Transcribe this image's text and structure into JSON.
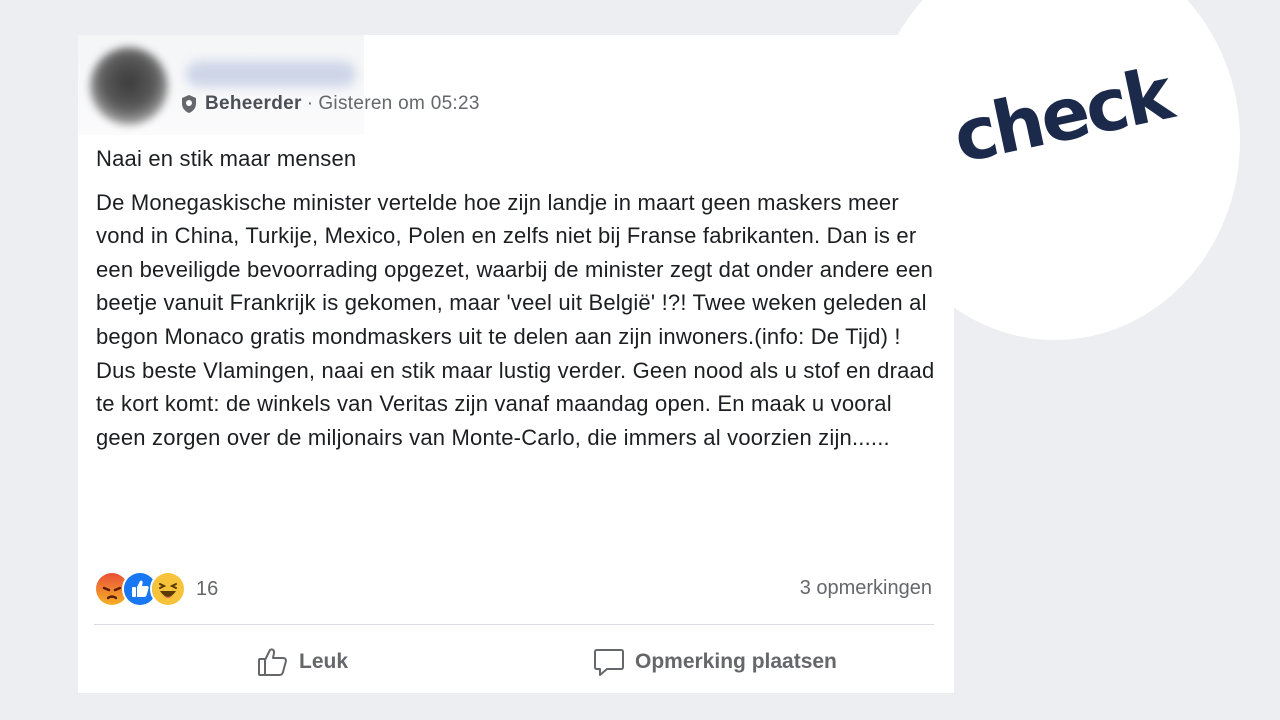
{
  "brand": {
    "word": "check",
    "color": "#1b2a4a"
  },
  "post": {
    "role": "Beheerder",
    "separator": "·",
    "timestamp": "Gisteren om 05:23",
    "title_line": "Naai en stik maar mensen",
    "paragraph_1": "De Monegaskische minister vertelde hoe zijn landje in maart geen maskers meer vond in China, Turkije, Mexico, Polen en zelfs niet bij Franse fabrikanten. Dan is er een beveiligde bevoorrading opgezet, waarbij de minister zegt dat onder andere een beetje vanuit Frankrijk is gekomen, maar 'veel uit België' !?! Twee weken geleden al begon Monaco gratis mondmaskers uit te delen aan zijn inwoners.(info: De Tijd) !",
    "paragraph_2": "Dus beste Vlamingen, naai en stik maar lustig verder. Geen nood als u stof en draad te kort komt: de winkels van Veritas zijn vanaf maandag open. En maak u vooral geen zorgen over de miljonairs van Monte-Carlo, die immers al voorzien zijn......"
  },
  "reactions": {
    "icons": [
      "angry-icon",
      "like-icon",
      "haha-icon"
    ],
    "count": "16",
    "comments": "3 opmerkingen"
  },
  "actions": {
    "like_label": "Leuk",
    "comment_label": "Opmerking plaatsen"
  }
}
